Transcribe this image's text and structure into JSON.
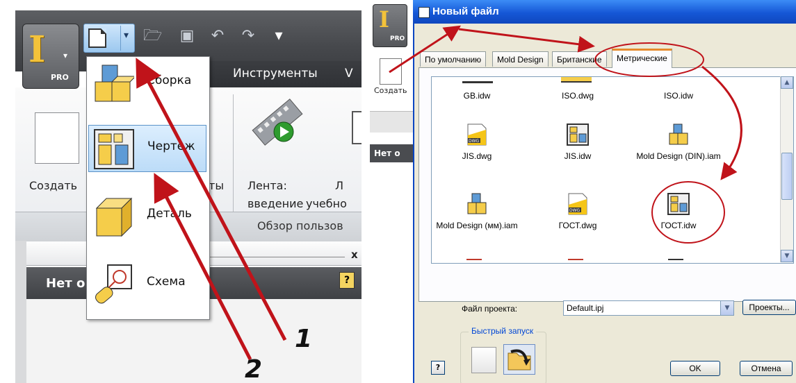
{
  "left": {
    "tab_tools": "Инструменты",
    "tab_partial": "V",
    "ribbon_create": "Создать",
    "ribbon_partial": "ты",
    "ribbon_tape": "Лента:",
    "ribbon_intro": "введение",
    "ribbon_l": "Л",
    "ribbon_tutor": "учебно",
    "ribbon_group": "Обзор пользов",
    "dark_bar": "Нет о",
    "logo_text": "PRO",
    "close_x": "x",
    "help": "?",
    "menu": [
      "Сборка",
      "Чертеж",
      "Деталь",
      "Схема"
    ],
    "annotation_1": "1",
    "annotation_2": "2"
  },
  "right": {
    "app_logo": "PRO",
    "app_create": "Создать",
    "app_dark": "Нет о",
    "dialog_title": "Новый файл",
    "tabs": [
      "По умолчанию",
      "Mold Design",
      "Британские",
      "Метрические"
    ],
    "files": [
      "GB.idw",
      "ISO.dwg",
      "ISO.idw",
      "JIS.dwg",
      "JIS.idw",
      "Mold Design (DIN).iam",
      "Mold Design (мм).iam",
      "ГОСТ.dwg",
      "ГОСТ.idw"
    ],
    "dwg_badge": "DWG",
    "project_label": "Файл проекта:",
    "project_value": "Default.ipj",
    "projects_button": "Проекты...",
    "quick_launch": "Быстрый запуск",
    "ok": "OK",
    "cancel": "Отмена",
    "help": "?"
  },
  "colors": {
    "annotation": "#c0131a",
    "xp_titlebar": "#1557d6",
    "active_tab": "#e68b2c",
    "selection": "#bcdcf8"
  }
}
